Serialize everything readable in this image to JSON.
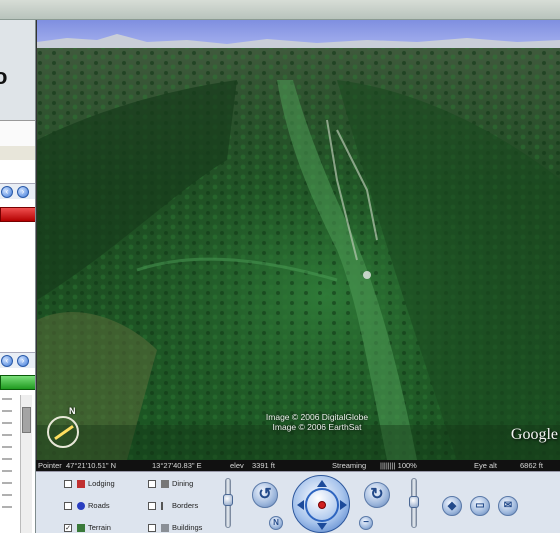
{
  "statusbar": {
    "pointer_label": "Pointer",
    "pointer_lat": "47°21'10.51\" N",
    "pointer_lon": "13°27'40.83\" E",
    "elev_label": "elev",
    "elev_value": "3391 ft",
    "streaming_label": "Streaming",
    "streaming_value": "|||||||| 100%",
    "eye_alt_label": "Eye alt",
    "eye_alt_value": "6862 ft"
  },
  "map": {
    "credit_line1": "Image © 2006 DigitalGlobe",
    "credit_line2": "Image © 2006 EarthSat",
    "logo_text": "Google",
    "compass_n": "N"
  },
  "layers": [
    {
      "label": "Lodging",
      "checked": false,
      "icon": "lodging-icon",
      "color": "#c03030"
    },
    {
      "label": "Dining",
      "checked": false,
      "icon": "dining-icon",
      "color": "#555555"
    },
    {
      "label": "Roads",
      "checked": false,
      "icon": "roads-icon",
      "color": "#c04040"
    },
    {
      "label": "Borders",
      "checked": false,
      "icon": "borders-icon",
      "color": "#555555"
    },
    {
      "label": "Terrain",
      "checked": true,
      "icon": "terrain-icon",
      "color": "#3a7a3a"
    },
    {
      "label": "Buildings",
      "checked": false,
      "icon": "buildings-icon",
      "color": "#555555"
    }
  ],
  "sidebar": {
    "logo_fragment": "o"
  },
  "controls": {
    "north_label": "N",
    "rotate_left_symbol": "↺",
    "rotate_right_symbol": "↻",
    "zoom_in_symbol": "+",
    "zoom_out_symbol": "−"
  },
  "colors": {
    "sidebar_red_bar": "#d02020",
    "sidebar_green_bar": "#3bb83b",
    "nav_accent": "#3d6fc0"
  }
}
